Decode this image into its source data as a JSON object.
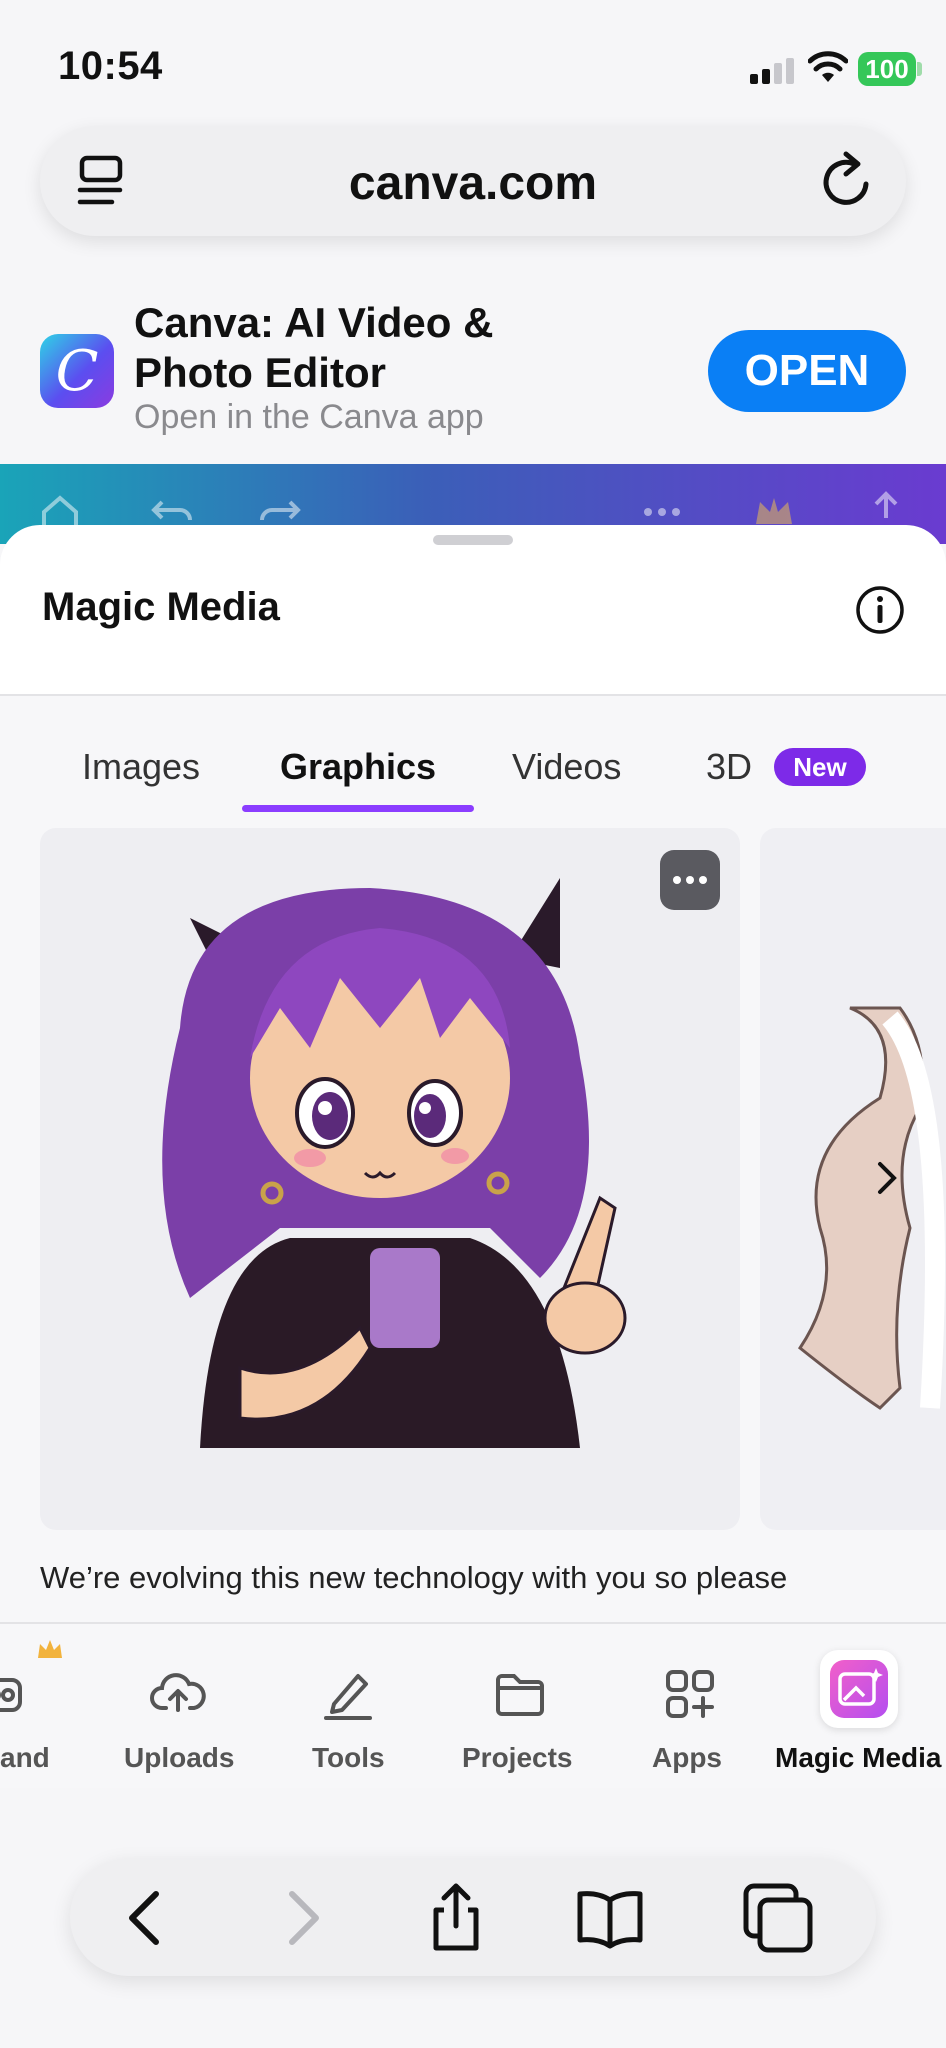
{
  "status_bar": {
    "time": "10:54",
    "battery": "100"
  },
  "browser": {
    "url": "canva.com"
  },
  "app_banner": {
    "logo_letter": "C",
    "title": "Canva: AI Video & Photo Editor",
    "subtitle": "Open in the Canva app",
    "open_label": "OPEN"
  },
  "sheet": {
    "title": "Magic Media",
    "tabs": [
      {
        "label": "Images"
      },
      {
        "label": "Graphics"
      },
      {
        "label": "Videos"
      },
      {
        "label": "3D"
      }
    ],
    "new_badge": "New",
    "selected_tab": "Graphics",
    "caption": "We’re evolving this new technology with you so please"
  },
  "editor_nav": {
    "items": [
      {
        "label": "and",
        "icon": "brand-icon"
      },
      {
        "label": "Uploads",
        "icon": "cloud-upload-icon"
      },
      {
        "label": "Tools",
        "icon": "pen-tool-icon"
      },
      {
        "label": "Projects",
        "icon": "folder-icon"
      },
      {
        "label": "Apps",
        "icon": "apps-icon"
      },
      {
        "label": "Magic Media",
        "icon": "magic-media-icon"
      }
    ]
  },
  "colors": {
    "accent": "#8b3dff",
    "open_button": "#0a7ff5",
    "battery": "#35c759"
  }
}
